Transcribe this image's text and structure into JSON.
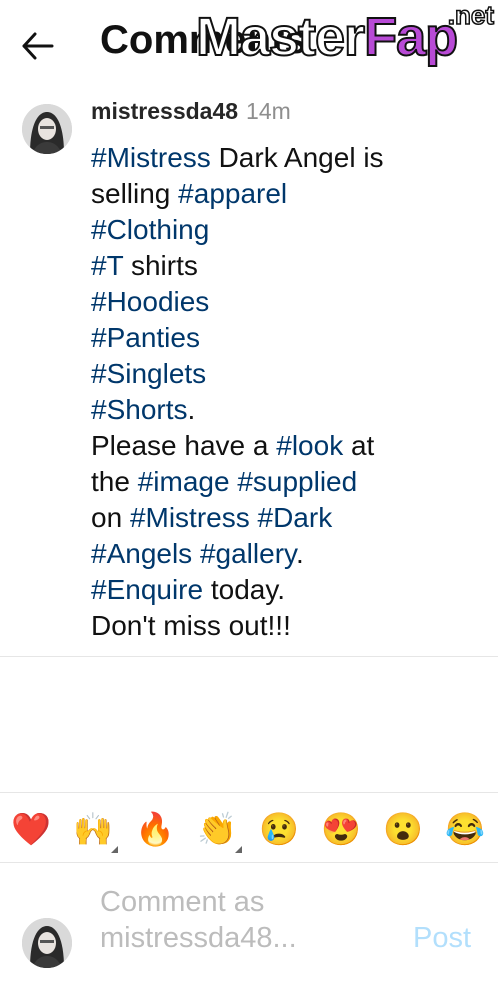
{
  "header": {
    "title": "Comments",
    "watermark": {
      "master": "Master",
      "fap": "Fap",
      "net": ".net"
    }
  },
  "post": {
    "username": "mistressda48",
    "time": "14m",
    "caption_lines": [
      [
        {
          "t": "#Mistress",
          "tag": true
        },
        {
          "t": " Dark Angel is",
          "tag": false
        }
      ],
      [
        {
          "t": "selling ",
          "tag": false
        },
        {
          "t": "#apparel",
          "tag": true
        }
      ],
      [
        {
          "t": "#Clothing",
          "tag": true
        }
      ],
      [
        {
          "t": "#T",
          "tag": true
        },
        {
          "t": " shirts",
          "tag": false
        }
      ],
      [
        {
          "t": "#Hoodies",
          "tag": true
        }
      ],
      [
        {
          "t": "#Panties",
          "tag": true
        }
      ],
      [
        {
          "t": "#Singlets",
          "tag": true
        }
      ],
      [
        {
          "t": "#Shorts",
          "tag": true
        },
        {
          "t": ".",
          "tag": false
        }
      ],
      [
        {
          "t": "Please have a ",
          "tag": false
        },
        {
          "t": "#look",
          "tag": true
        },
        {
          "t": " at",
          "tag": false
        }
      ],
      [
        {
          "t": "the ",
          "tag": false
        },
        {
          "t": "#image",
          "tag": true
        },
        {
          "t": " ",
          "tag": false
        },
        {
          "t": "#supplied",
          "tag": true
        }
      ],
      [
        {
          "t": "on ",
          "tag": false
        },
        {
          "t": "#Mistress",
          "tag": true
        },
        {
          "t": " ",
          "tag": false
        },
        {
          "t": "#Dark",
          "tag": true
        }
      ],
      [
        {
          "t": "#Angels",
          "tag": true
        },
        {
          "t": " ",
          "tag": false
        },
        {
          "t": "#gallery",
          "tag": true
        },
        {
          "t": ".",
          "tag": false
        }
      ],
      [
        {
          "t": "#Enquire",
          "tag": true
        },
        {
          "t": " today.",
          "tag": false
        }
      ],
      [
        {
          "t": "Don't miss out!!!",
          "tag": false
        }
      ]
    ]
  },
  "emoji_reactions": [
    {
      "name": "heart",
      "char": "❤️",
      "more": false
    },
    {
      "name": "raising-hands",
      "char": "🙌",
      "more": true
    },
    {
      "name": "fire",
      "char": "🔥",
      "more": false
    },
    {
      "name": "clapping-hands",
      "char": "👏",
      "more": true
    },
    {
      "name": "crying-face",
      "char": "😢",
      "more": false
    },
    {
      "name": "heart-eyes",
      "char": "😍",
      "more": false
    },
    {
      "name": "surprised-face",
      "char": "😮",
      "more": false
    },
    {
      "name": "tears-of-joy",
      "char": "😂",
      "more": false
    }
  ],
  "comment_box": {
    "placeholder": "Comment as mistressda48...",
    "post_label": "Post"
  },
  "colors": {
    "hashtag": "#00376b",
    "post_button": "#b2dffc",
    "placeholder": "#bcbcbc"
  }
}
